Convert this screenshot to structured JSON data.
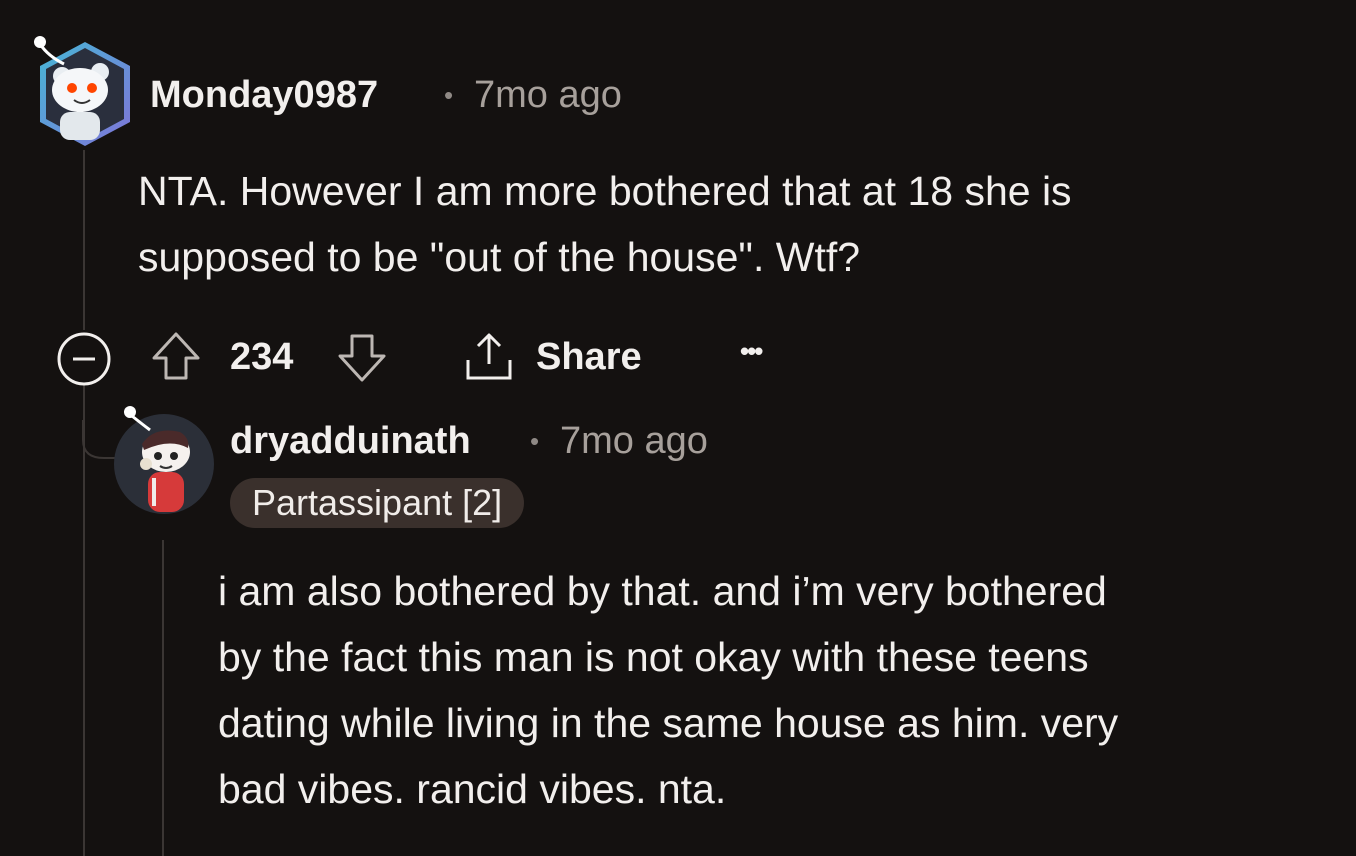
{
  "comment": {
    "username": "Monday0987",
    "separator": "•",
    "time": "7mo ago",
    "body_line1": "NTA. However I am more bothered that at 18 she is",
    "body_line2": "supposed to be \"out of the house\". Wtf?",
    "score": "234",
    "share_label": "Share",
    "more_label": "•••"
  },
  "reply": {
    "username": "dryadduinath",
    "separator": "•",
    "time": "7mo ago",
    "flair": "Partassipant [2]",
    "body_line1": "i am also bothered by that. and i’m very bothered",
    "body_line2": "by the fact this man is not okay with these teens",
    "body_line3": "dating while living in the same house as him. very",
    "body_line4": "bad vibes. rancid vibes. nta."
  },
  "colors": {
    "background": "#141110",
    "text": "#f2efed",
    "muted": "#a7a09b",
    "thread_line": "#3b3634",
    "flair_bg": "#3a302c"
  },
  "icons": {
    "collapse": "minus-circle-icon",
    "upvote": "arrow-up-icon",
    "downvote": "arrow-down-icon",
    "share": "share-icon",
    "more": "ellipsis-icon"
  }
}
